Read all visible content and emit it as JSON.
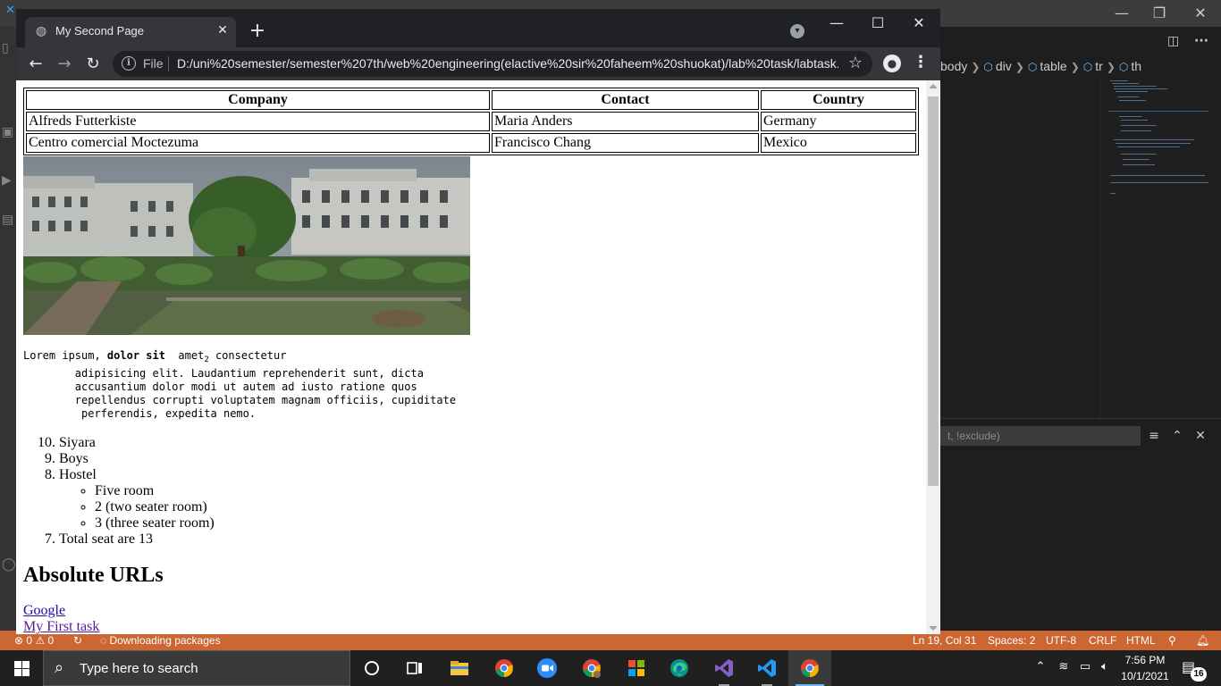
{
  "vscode": {
    "breadcrumb": [
      "body",
      "div",
      "table",
      "tr",
      "th"
    ],
    "find_placeholder": "t, !exclude)",
    "status": {
      "errors": "0",
      "warnings": "0",
      "downloading": "Downloading packages",
      "position": "Ln 19, Col 31",
      "spaces": "Spaces: 2",
      "encoding": "UTF-8",
      "eol": "CRLF",
      "language": "HTML"
    }
  },
  "browser": {
    "tab_title": "My Second Page",
    "omnibox_scheme": "File",
    "url": "D:/uni%20semester/semester%207th/web%20engineering(elactive%20sir%20faheem%20shuokat)/lab%20task/labtask..."
  },
  "page": {
    "table": {
      "headers": [
        "Company",
        "Contact",
        "Country"
      ],
      "rows": [
        [
          "Alfreds Futterkiste",
          "Maria Anders",
          "Germany"
        ],
        [
          "Centro comercial Moctezuma",
          "Francisco Chang",
          "Mexico"
        ]
      ]
    },
    "pre": {
      "line1_a": "Lorem ipsum, ",
      "line1_bold": "dolor sit",
      "line1_b": "  amet",
      "line1_sub": "2",
      "line1_c": " consectetur",
      "line2": "        adipisicing elit. Laudantium reprehenderit sunt, dicta",
      "line3": "        accusantium dolor modi ut autem ad iusto ratione quos",
      "line4": "        repellendus corrupti voluptatem magnam officiis, cupiditate",
      "line5": "         perferendis, expedita nemo."
    },
    "ordered_list": [
      {
        "number": "10.",
        "text": "Siyara"
      },
      {
        "number": "9.",
        "text": "Boys"
      },
      {
        "number": "8.",
        "text": "Hostel"
      },
      {
        "number": "7.",
        "text": "Total seat are 13"
      }
    ],
    "hostel_sub_list": [
      "Five room",
      "2 (two seater room)",
      "3 (three seater room)"
    ],
    "heading": "Absolute URLs",
    "links": [
      "Google",
      "My First task"
    ]
  },
  "taskbar": {
    "search_placeholder": "Type here to search",
    "time": "7:56 PM",
    "date": "10/1/2021",
    "notification_count": "16"
  }
}
